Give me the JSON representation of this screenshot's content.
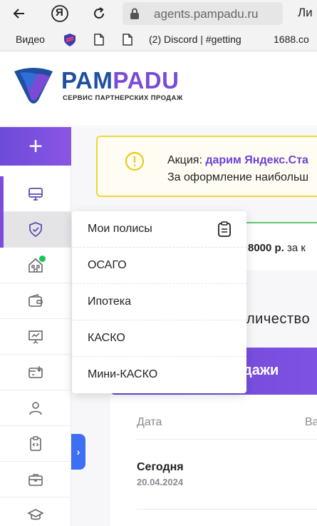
{
  "browser": {
    "url": "agents.pampadu.ru",
    "url_tail": "Ли",
    "ya_label": "Я",
    "bookmarks": [
      {
        "label": "Видео",
        "icon": "none"
      },
      {
        "label": "",
        "icon": "shield-logo-icon"
      },
      {
        "label": "",
        "icon": "page-icon"
      },
      {
        "label": "(2) Discord | #getting",
        "icon": "page-icon"
      },
      {
        "label": "1688.co",
        "icon": "none"
      }
    ]
  },
  "header": {
    "brand_part1": "PAM",
    "brand_part2": "PADU",
    "tagline": "СЕРВИС ПАРТНЕРСКИХ ПРОДАЖ",
    "brand_color_primary": "#1e4fa0",
    "brand_color_accent": "#7b4bd6"
  },
  "sidebar": {
    "add_label": "+",
    "items": [
      {
        "icon": "monitor-icon"
      },
      {
        "icon": "shield-check-icon",
        "active": true
      },
      {
        "icon": "house-icon",
        "badge": true
      },
      {
        "icon": "wallet-icon"
      },
      {
        "icon": "presentation-icon"
      },
      {
        "icon": "card-download-icon"
      },
      {
        "icon": "user-icon"
      },
      {
        "icon": "clipboard-code-icon"
      },
      {
        "icon": "briefcase-icon"
      },
      {
        "icon": "graduation-cap-icon"
      }
    ],
    "expand_label": "›"
  },
  "promo": {
    "prefix": "Акция: ",
    "highlight": "дарим Яндекс.Ста",
    "line2": "За оформление наибольш"
  },
  "bonus": {
    "amount": "8000 р.",
    "suffix": " за к"
  },
  "section_title": "личество",
  "sales_button_label": "дажи",
  "table": {
    "col_date": "Дата",
    "col_2": "Ва",
    "row_day": "Сегодня",
    "row_date": "20.04.2024"
  },
  "menu": {
    "items": [
      {
        "label": "Мои полисы",
        "icon": "clipboard-icon"
      },
      {
        "label": "ОСАГО"
      },
      {
        "label": "Ипотека"
      },
      {
        "label": "КАСКО"
      },
      {
        "label": "Мини-КАСКО"
      }
    ]
  }
}
